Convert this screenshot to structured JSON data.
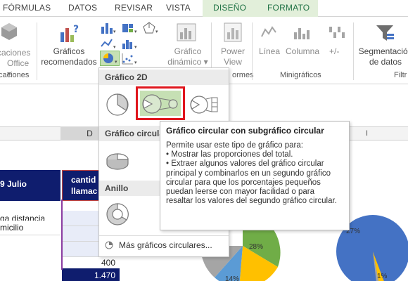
{
  "tabs": [
    "FÓRMULAS",
    "DATOS",
    "REVISAR",
    "VISTA",
    "DISEÑO",
    "FORMATO"
  ],
  "ribbon": {
    "addins_label_1": "caciones",
    "addins_label_2": "Office",
    "addins_group": "caciones",
    "recommended_label_1": "Gráficos",
    "recommended_label_2": "recomendados",
    "pivot_label_1": "Gráfico",
    "pivot_label_2": "dinámico",
    "power_label_1": "Power",
    "power_label_2": "View",
    "informes_group": "ormes",
    "sparkline_line": "Línea",
    "sparkline_column": "Columna",
    "sparkline_winloss": "+/-",
    "sparklines_group": "Minigráficos",
    "slicer_label_1": "Segmentación",
    "slicer_label_2": "de datos",
    "filters_group": "Filtr"
  },
  "sheet": {
    "col_d": "D",
    "col_i": "I",
    "header_left": "9 Julio",
    "header_right_1": "cantid",
    "header_right_2": "llamac",
    "row1": "ga distancia",
    "row2": "micilio",
    "val1": "400",
    "val2": "1.470",
    "pct_28": "28%",
    "pct_14": "14%",
    "pct_27": "27%",
    "pct_1": "1%"
  },
  "dropdown": {
    "section_2d": "Gráfico 2D",
    "section_3d": "Gráfico circular",
    "section_ring": "Anillo",
    "more": "Más gráficos circulares..."
  },
  "tooltip": {
    "title": "Gráfico circular con subgráfico circular",
    "intro": "Permite usar este tipo de gráfico para:",
    "bullet1": "• Mostrar las proporciones del total.",
    "bullet2": "• Extraer algunos valores del gráfico circular principal y combinarlos en un segundo gráfico circular para que los porcentajes pequeños puedan leerse con mayor facilidad o para resaltar los valores del segundo gráfico circular."
  },
  "colors": {
    "accent_green": "#217346",
    "context_tab": "#e2efda",
    "header_blue": "#0f1d6e",
    "highlight_red": "#e0161d",
    "pie_blue": "#4472c4",
    "pie_green": "#70ad47",
    "pie_grey": "#a5a5a5",
    "pie_yellow": "#ffc000"
  }
}
